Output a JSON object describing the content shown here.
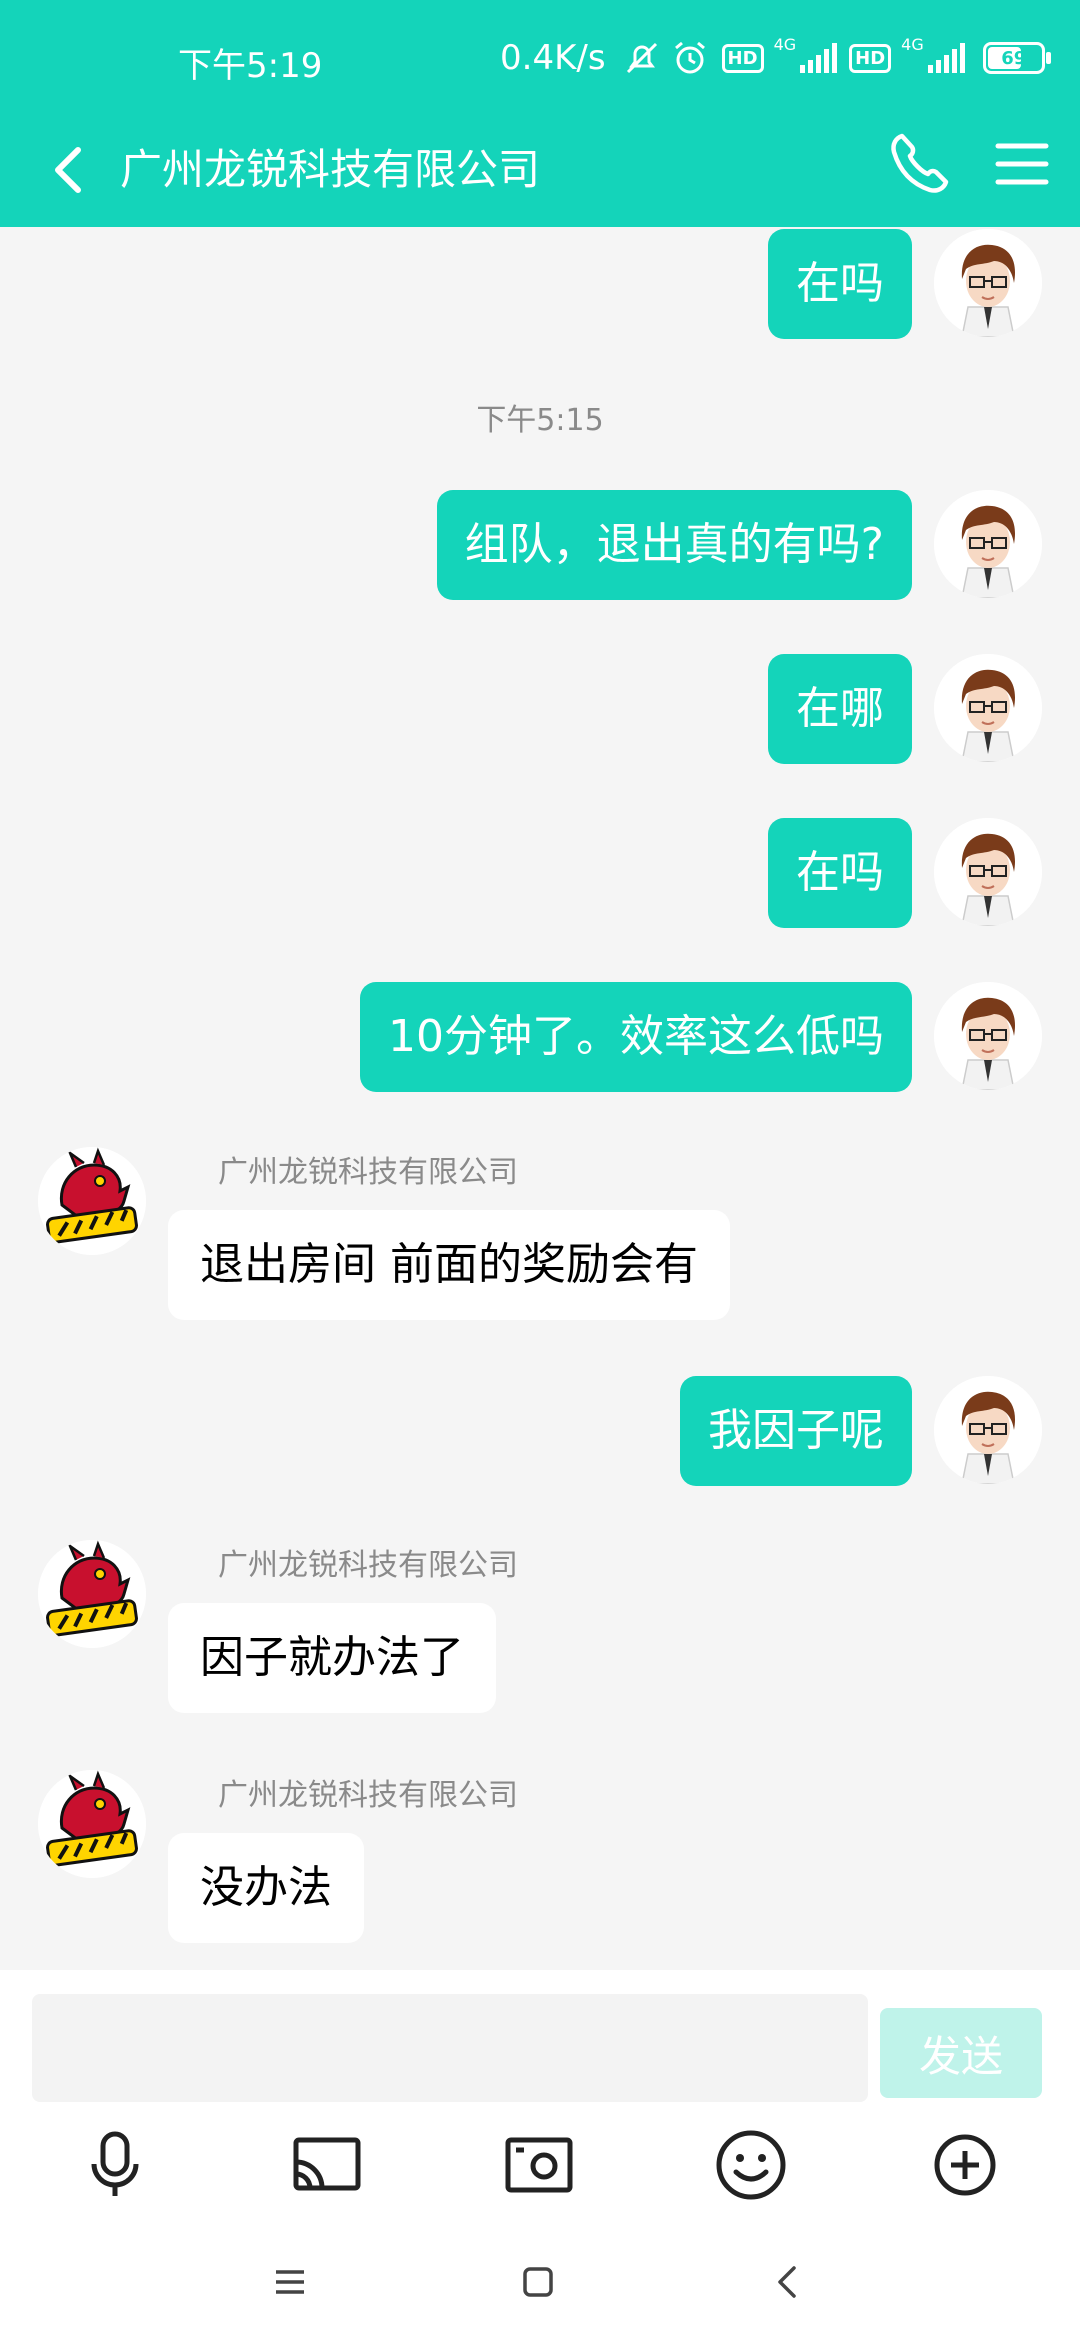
{
  "status_bar": {
    "time": "下午5:19",
    "net_speed": "0.4K/s",
    "hd_label": "HD",
    "network_type": "4G",
    "battery_level": "69"
  },
  "header": {
    "title": "广州龙锐科技有限公司"
  },
  "messages": [
    {
      "side": "me",
      "text": "在吗"
    },
    {
      "type": "timestamp",
      "text": "下午5:15"
    },
    {
      "side": "me",
      "text": "组队，退出真的有吗?"
    },
    {
      "side": "me",
      "text": "在哪"
    },
    {
      "side": "me",
      "text": "在吗"
    },
    {
      "side": "me",
      "text": "10分钟了。效率这么低吗"
    },
    {
      "side": "them",
      "sender": "广州龙锐科技有限公司",
      "text": "退出房间 前面的奖励会有"
    },
    {
      "side": "me",
      "text": "我因子呢"
    },
    {
      "side": "them",
      "sender": "广州龙锐科技有限公司",
      "text": "因子就办法了"
    },
    {
      "side": "them",
      "sender": "广州龙锐科技有限公司",
      "text": "没办法"
    }
  ],
  "input": {
    "value": "",
    "placeholder": "",
    "send_label": "发送"
  },
  "colors": {
    "accent": "#14d4ba",
    "send_disabled": "#bff3ea"
  },
  "icons": {
    "toolbar": [
      "microphone-icon",
      "cast-screen-icon",
      "photo-camera-icon",
      "emoji-icon",
      "plus-circle-icon"
    ],
    "nav": [
      "menu-lines-icon",
      "home-square-icon",
      "back-chevron-icon"
    ]
  }
}
